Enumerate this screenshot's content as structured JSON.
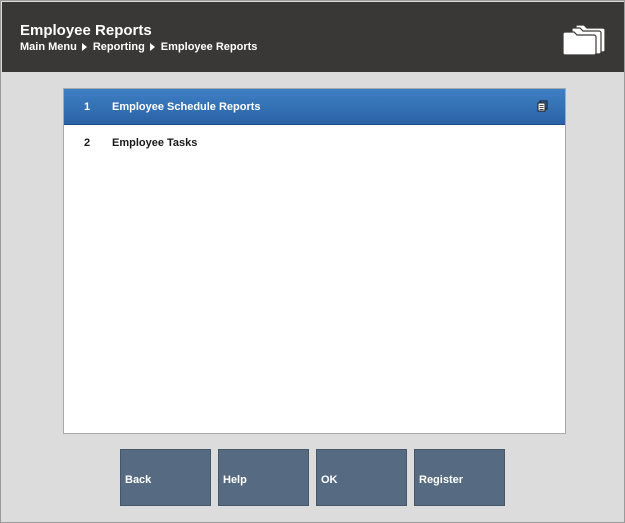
{
  "header": {
    "title": "Employee Reports",
    "breadcrumb": [
      "Main Menu",
      "Reporting",
      "Employee Reports"
    ],
    "icon": "folder-stack-icon"
  },
  "list": {
    "items": [
      {
        "number": "1",
        "label": "Employee Schedule Reports",
        "selected": true,
        "icon": "submenu-icon"
      },
      {
        "number": "2",
        "label": "Employee Tasks",
        "selected": false
      }
    ]
  },
  "buttons": {
    "back": "Back",
    "help": "Help",
    "ok": "OK",
    "register": "Register"
  },
  "colors": {
    "header_bg": "#3a3836",
    "selected_row": "#3470b3",
    "button_bg": "#566b82",
    "page_bg": "#dcdcdc"
  }
}
